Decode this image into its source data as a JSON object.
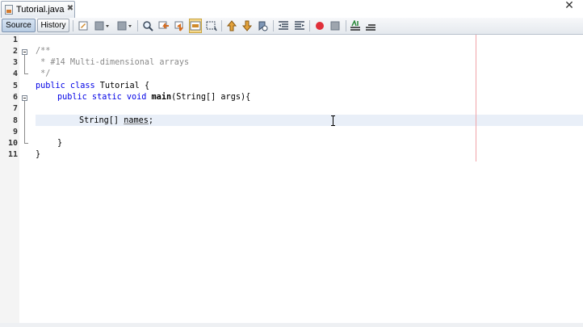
{
  "tab": {
    "title": "Tutorial.java",
    "close": "✖"
  },
  "window": {
    "close": "✕"
  },
  "toolbar": {
    "source_label": "Source",
    "history_label": "History",
    "icons": [
      "last-edit-icon",
      "back-icon",
      "forward-icon",
      "find-selection-icon",
      "find-previous-icon",
      "find-next-icon",
      "toggle-highlight-icon",
      "toggle-rect-selection-icon",
      "previous-bookmark-icon",
      "next-bookmark-icon",
      "toggle-bookmark-icon",
      "shift-left-icon",
      "shift-right-icon",
      "start-macro-icon",
      "stop-macro-icon",
      "comment-icon",
      "uncomment-icon"
    ]
  },
  "editor": {
    "line_numbers": [
      "1",
      "2",
      "3",
      "4",
      "5",
      "6",
      "7",
      "8",
      "9",
      "10",
      "11"
    ],
    "lines": [
      {
        "n": 1,
        "text": ""
      },
      {
        "n": 2,
        "text": "/**"
      },
      {
        "n": 3,
        "text": " * #14 Multi-dimensional arrays"
      },
      {
        "n": 4,
        "text": " */"
      },
      {
        "n": 5,
        "kw": "public class",
        "rest": " Tutorial {"
      },
      {
        "n": 6,
        "kw": "public static void",
        "fn": "main",
        "rest": "(String[] args){"
      },
      {
        "n": 7,
        "text": ""
      },
      {
        "n": 8,
        "type": "String[]",
        "var": "names",
        "end": ";"
      },
      {
        "n": 9,
        "text": ""
      },
      {
        "n": 10,
        "text": "}"
      },
      {
        "n": 11,
        "text": "}"
      }
    ]
  },
  "colors": {
    "keyword": "#0000e6",
    "comment": "#8a8a8a",
    "current_line": "#e9eff8",
    "margin_line": "#f0a3a8"
  }
}
